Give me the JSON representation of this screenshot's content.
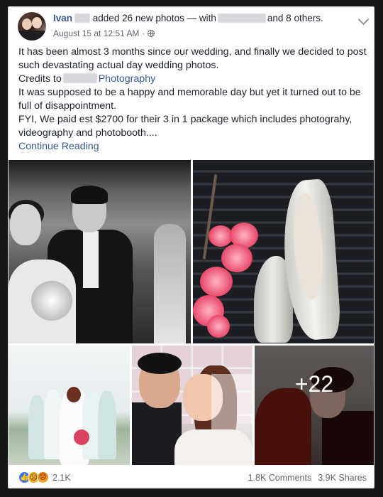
{
  "post": {
    "author": "Ivan",
    "action_text": "added 26 new photos — with",
    "and_others": "and 8 others.",
    "timestamp": "August 15 at 12:51 AM",
    "privacy_icon": "globe-icon",
    "body_lines": [
      "It has been almost 3 months since our wedding, and finally we decided to post such devastating actual day wedding photos.",
      "It was supposed to be a happy and memorable day but yet it turned out to be full of disappointment.",
      "FYI, We paid est $2700 for their 3 in 1 package which includes photograhy, videography and photobooth...."
    ],
    "credits_prefix": "Credits to",
    "credits_link": "Photography",
    "continue_reading": "Continue Reading"
  },
  "photos": {
    "more_count": "+22"
  },
  "footer": {
    "reaction_icons": [
      "like-icon",
      "sad-icon",
      "angry-icon"
    ],
    "reaction_count": "2.1K",
    "comments": "1.8K Comments",
    "shares": "3.9K Shares"
  },
  "colors": {
    "link": "#365899",
    "text": "#1d2129",
    "meta": "#616770",
    "background": "#161616",
    "like": "#3578e5",
    "sad": "#f7b125"
  }
}
